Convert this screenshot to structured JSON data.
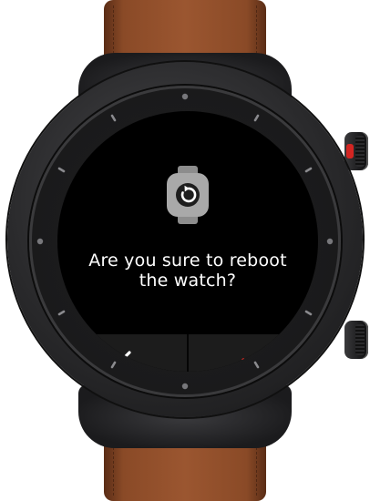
{
  "dialog": {
    "icon": "watch-reboot-icon",
    "message_line1": "Are you sure to reboot",
    "message_line2": "the watch?",
    "cancel_icon": "close-icon",
    "confirm_icon": "check-icon"
  },
  "colors": {
    "screen_background": "#000000",
    "action_bar_background": "#1c1c1c",
    "cancel_icon_color": "#ffffff",
    "confirm_icon_color": "#e02a24",
    "strap_color": "#9b5630",
    "crown_accent": "#d32522"
  }
}
